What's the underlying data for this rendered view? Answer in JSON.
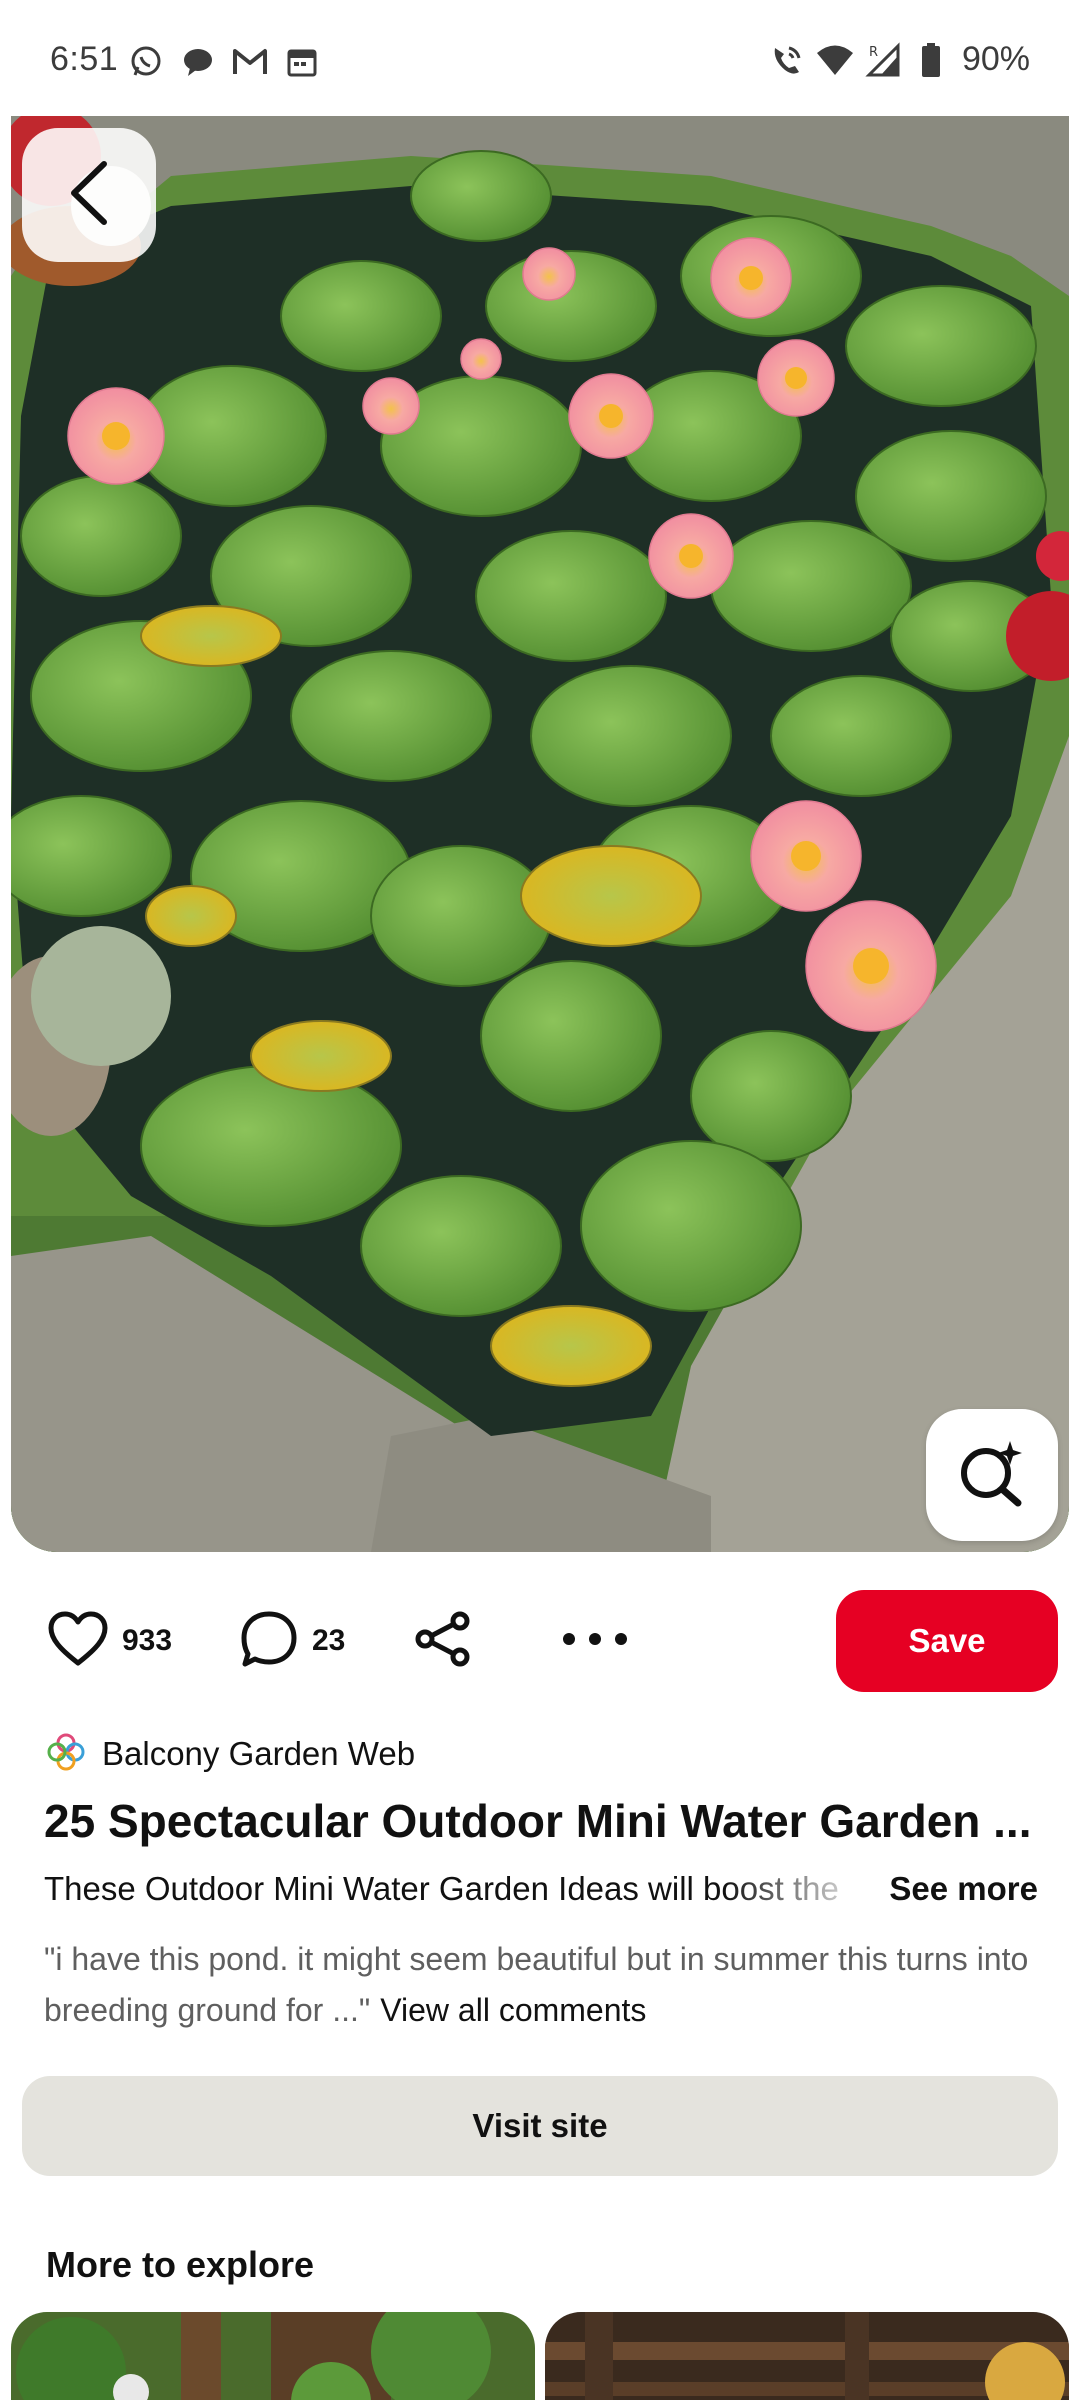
{
  "status_bar": {
    "time": "6:51",
    "battery": "90%",
    "left_icons": [
      "whatsapp-icon",
      "chat-bubble-icon",
      "gmail-icon",
      "calendar-icon"
    ],
    "right_icons": [
      "wifi-calling-icon",
      "wifi-icon",
      "signal-roaming-icon",
      "battery-icon"
    ]
  },
  "pin": {
    "likes": "933",
    "comments": "23",
    "save_label": "Save",
    "source_name": "Balcony Garden Web",
    "title": "25 Spectacular Outdoor Mini Water Garden ...",
    "description": "These Outdoor Mini Water Garden Ideas will boost the",
    "see_more": "See more",
    "top_comment": "\"i have this pond. it might seem beautiful but in summer this turns into breeding ground for ...\"",
    "view_all_comments": "View all comments",
    "visit_site": "Visit site"
  },
  "more_to_explore": {
    "title": "More to explore"
  },
  "colors": {
    "save_red": "#e60023",
    "visit_gray": "#e4e3dd"
  }
}
